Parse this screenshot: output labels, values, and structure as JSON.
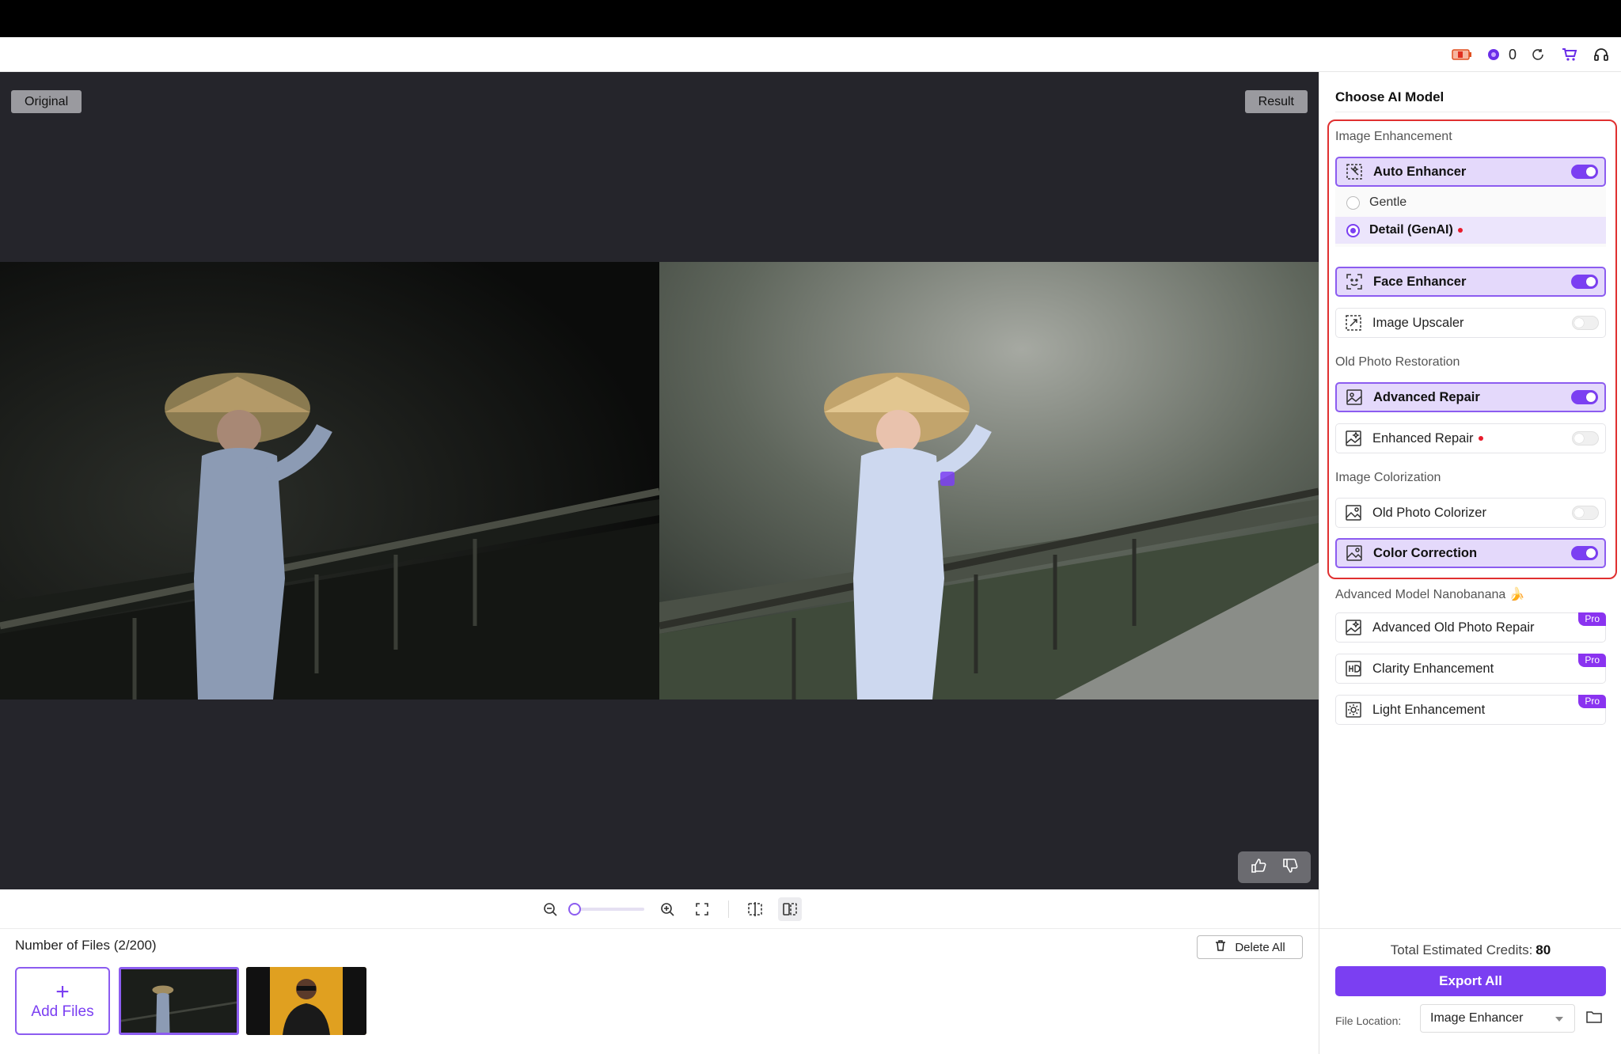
{
  "header": {
    "credit_count": "0"
  },
  "canvas": {
    "original_label": "Original",
    "result_label": "Result"
  },
  "files": {
    "title": "Number of Files (2/200)",
    "delete_all": "Delete All",
    "add_files": "Add Files",
    "add_plus": "+"
  },
  "sidebar": {
    "title": "Choose AI Model",
    "sections": {
      "image_enhancement": "Image Enhancement",
      "old_photo_restoration": "Old Photo Restoration",
      "image_colorization": "Image Colorization",
      "nanobanana": "Advanced Model Nanobanana 🍌"
    },
    "items": {
      "auto_enhancer": "Auto Enhancer",
      "gentle": "Gentle",
      "detail_genai": "Detail (GenAI)",
      "face_enhancer": "Face Enhancer",
      "image_upscaler": "Image Upscaler",
      "advanced_repair": "Advanced Repair",
      "enhanced_repair": "Enhanced Repair",
      "old_photo_colorizer": "Old Photo Colorizer",
      "color_correction": "Color Correction",
      "advanced_old_photo_repair": "Advanced Old Photo Repair",
      "clarity_enhancement": "Clarity Enhancement",
      "light_enhancement": "Light Enhancement"
    },
    "pro_badge": "Pro",
    "footer": {
      "credits_label": "Total Estimated Credits:",
      "credits_value": "80",
      "export_all": "Export All",
      "file_location_label": "File Location:",
      "file_location_value": "Image Enhancer"
    }
  },
  "colors": {
    "accent": "#7b3ff2",
    "highlight_border": "#e03030",
    "canvas_bg": "#25252b"
  }
}
